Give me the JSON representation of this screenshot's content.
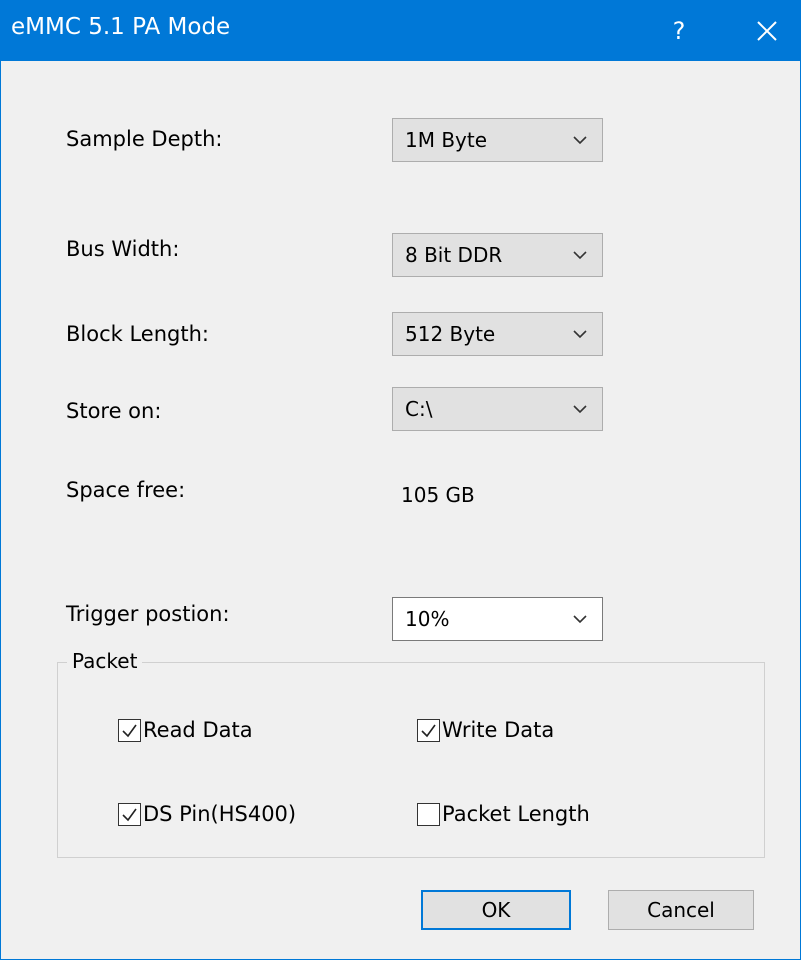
{
  "window": {
    "title": "eMMC 5.1 PA Mode",
    "help_label": "?"
  },
  "fields": {
    "sample_depth": {
      "label": "Sample Depth:",
      "value": "1M Byte"
    },
    "bus_width": {
      "label": "Bus Width:",
      "value": "8 Bit DDR"
    },
    "block_length": {
      "label": "Block Length:",
      "value": "512 Byte"
    },
    "store_on": {
      "label": "Store on:",
      "value": "C:\\"
    },
    "space_free": {
      "label": "Space free:",
      "value": "105 GB"
    },
    "trigger_position": {
      "label": "Trigger postion:",
      "value": "10%"
    }
  },
  "packet": {
    "title": "Packet",
    "read_data": {
      "label": "Read Data",
      "checked": true
    },
    "write_data": {
      "label": "Write Data",
      "checked": true
    },
    "ds_pin": {
      "label": "DS Pin(HS400)",
      "checked": true
    },
    "packet_length": {
      "label": "Packet Length",
      "checked": false
    }
  },
  "buttons": {
    "ok": "OK",
    "cancel": "Cancel"
  },
  "colors": {
    "titlebar": "#0078d7",
    "dialog_bg": "#f0f0f0",
    "combo_bg": "#e1e1e1"
  }
}
